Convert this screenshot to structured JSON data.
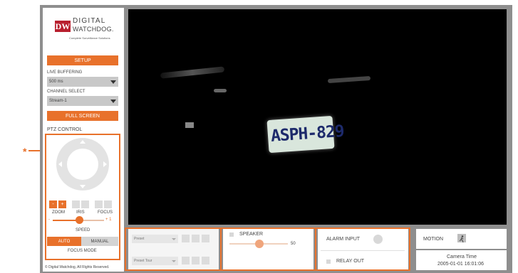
{
  "logo": {
    "brand_line1": "DIGITAL",
    "brand_line2": "WATCHDOG.",
    "mark": "DW",
    "tagline": "Complete Surveillance Solutions"
  },
  "sidebar": {
    "setup_label": "SETUP",
    "live_buffering_label": "LIVE BUFFERING",
    "live_buffering_value": "500 ms",
    "channel_select_label": "CHANNEL SELECT",
    "channel_select_value": "Stream-1",
    "full_screen_label": "FULL SCREEN",
    "ptz_control_label": "PTZ CONTROL",
    "zoom_label": "ZOOM",
    "iris_label": "IRIS",
    "focus_label": "FOCUS",
    "zoom_minus": "-",
    "zoom_plus": "+",
    "speed_min": "-",
    "speed_max": "+ 1",
    "speed_label": "SPEED",
    "auto_label": "AUTO",
    "manual_label": "MANUAL",
    "focus_mode_label": "FOCUS MODE",
    "copyright": "© Digital Watchdog, All Rights Reserved."
  },
  "video": {
    "plate_text": "ASPH-829"
  },
  "bottom": {
    "preset_label": "Preset",
    "preset_tour_label": "Preset Tour",
    "speaker_label": "SPEAKER",
    "speaker_volume": "50",
    "alarm_input_label": "ALARM INPUT",
    "relay_out_label": "RELAY OUT",
    "motion_label": "MOTION",
    "camera_time_label": "Camera Time",
    "camera_time_value": "2005-01-01 16:01:06"
  },
  "annotation": {
    "marker": "*"
  },
  "colors": {
    "accent": "#e8712b",
    "frame": "#8e8e8e",
    "video_bg": "#000000",
    "brand_red": "#b8202f"
  },
  "icons": [
    "ptz-direction-pad-icon",
    "motion-running-person-icon",
    "alarm-indicator-icon",
    "speaker-checkbox-icon",
    "relay-checkbox-icon"
  ]
}
